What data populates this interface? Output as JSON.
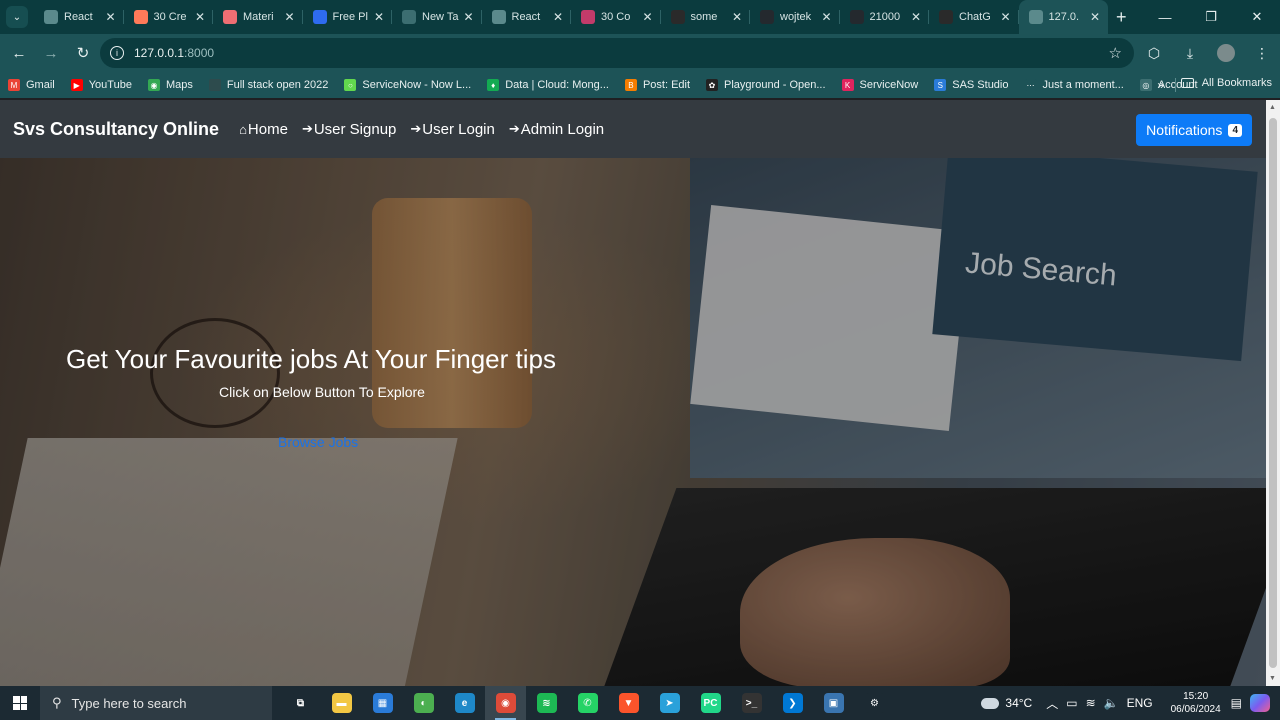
{
  "browser": {
    "tabs": [
      {
        "title": "React",
        "favicon": "react-icon",
        "color": "#5b8a8c"
      },
      {
        "title": "30 Cre",
        "favicon": "hubspot-icon",
        "color": "#ff7a59"
      },
      {
        "title": "Materi",
        "favicon": "materialize-icon",
        "color": "#ee6e73"
      },
      {
        "title": "Free Pl",
        "favicon": "f-icon",
        "color": "#2e6bf0"
      },
      {
        "title": "New Ta",
        "favicon": "chrome-icon",
        "color": "#3c6e71"
      },
      {
        "title": "React",
        "favicon": "react-icon",
        "color": "#5b8a8c"
      },
      {
        "title": "30 Co",
        "favicon": "mail-icon",
        "color": "#c23b6a"
      },
      {
        "title": "some",
        "favicon": "openai-icon",
        "color": "#2a2a2a"
      },
      {
        "title": "wojtek",
        "favicon": "github-icon",
        "color": "#24292e"
      },
      {
        "title": "21000",
        "favicon": "github-icon",
        "color": "#24292e"
      },
      {
        "title": "ChatG",
        "favicon": "openai-icon",
        "color": "#2a2a2a"
      },
      {
        "title": "127.0.",
        "favicon": "globe-icon",
        "color": "#5b8a8c"
      }
    ],
    "active_tab_index": 11,
    "address": {
      "host": "127.0.0.1",
      "port": ":8000"
    },
    "bookmarks": [
      {
        "label": "Gmail",
        "color": "#ea4335",
        "glyph": "M"
      },
      {
        "label": "YouTube",
        "color": "#ff0000",
        "glyph": "▶"
      },
      {
        "label": "Maps",
        "color": "#34a853",
        "glyph": "◉"
      },
      {
        "label": "Full stack open 2022",
        "color": "#2d4b4d",
        "glyph": ""
      },
      {
        "label": "ServiceNow - Now L...",
        "color": "#62d84e",
        "glyph": "○"
      },
      {
        "label": "Data | Cloud: Mong...",
        "color": "#13aa52",
        "glyph": "♦"
      },
      {
        "label": "Post: Edit",
        "color": "#f57d00",
        "glyph": "B"
      },
      {
        "label": "Playground - Open...",
        "color": "#222222",
        "glyph": "✿"
      },
      {
        "label": "ServiceNow",
        "color": "#e0245e",
        "glyph": "K"
      },
      {
        "label": "SAS Studio",
        "color": "#2a7bd8",
        "glyph": "S"
      },
      {
        "label": "Just a moment...",
        "color": "#1d5357",
        "glyph": "⋯"
      },
      {
        "label": "Account",
        "color": "#3c6e71",
        "glyph": "◎"
      }
    ],
    "all_bookmarks_label": "All Bookmarks"
  },
  "site": {
    "brand": "Svs Consultancy Online",
    "nav": [
      {
        "label": "Home",
        "icon": "home-icon"
      },
      {
        "label": "User Signup",
        "icon": "sign-in-icon"
      },
      {
        "label": "User Login",
        "icon": "sign-in-icon"
      },
      {
        "label": "Admin Login",
        "icon": "sign-in-icon"
      }
    ],
    "notifications": {
      "label": "Notifications",
      "count": "4"
    },
    "hero": {
      "headline": "Get Your Favourite jobs At Your Finger tips",
      "subline": "Click on Below Button To Explore",
      "cta": "Browse Jobs"
    }
  },
  "taskbar": {
    "search_placeholder": "Type here to search",
    "apps": [
      {
        "name": "task-view",
        "color": "#1c2a33",
        "glyph": "⧉"
      },
      {
        "name": "file-explorer",
        "color": "#f2c744",
        "glyph": "▬"
      },
      {
        "name": "microsoft-store",
        "color": "#2a7bd8",
        "glyph": "▦"
      },
      {
        "name": "chrome-canary",
        "color": "#4caf50",
        "glyph": "◐"
      },
      {
        "name": "edge",
        "color": "#1e88c8",
        "glyph": "e"
      },
      {
        "name": "chrome",
        "color": "#dd4b39",
        "glyph": "◉"
      },
      {
        "name": "spotify",
        "color": "#1db954",
        "glyph": "≋"
      },
      {
        "name": "whatsapp",
        "color": "#25d366",
        "glyph": "✆"
      },
      {
        "name": "brave",
        "color": "#fb542b",
        "glyph": "▼"
      },
      {
        "name": "telegram",
        "color": "#2aa1da",
        "glyph": "➤"
      },
      {
        "name": "pycharm",
        "color": "#21d789",
        "glyph": "PC"
      },
      {
        "name": "terminal",
        "color": "#333333",
        "glyph": ">_"
      },
      {
        "name": "vscode",
        "color": "#0078d4",
        "glyph": "❯"
      },
      {
        "name": "python-idle",
        "color": "#3a75b0",
        "glyph": "▣"
      },
      {
        "name": "settings",
        "color": "#1c2a33",
        "glyph": "⚙"
      }
    ],
    "active_app_index": 5,
    "weather": "34°C",
    "language": "ENG",
    "time": "15:20",
    "date": "06/06/2024"
  }
}
